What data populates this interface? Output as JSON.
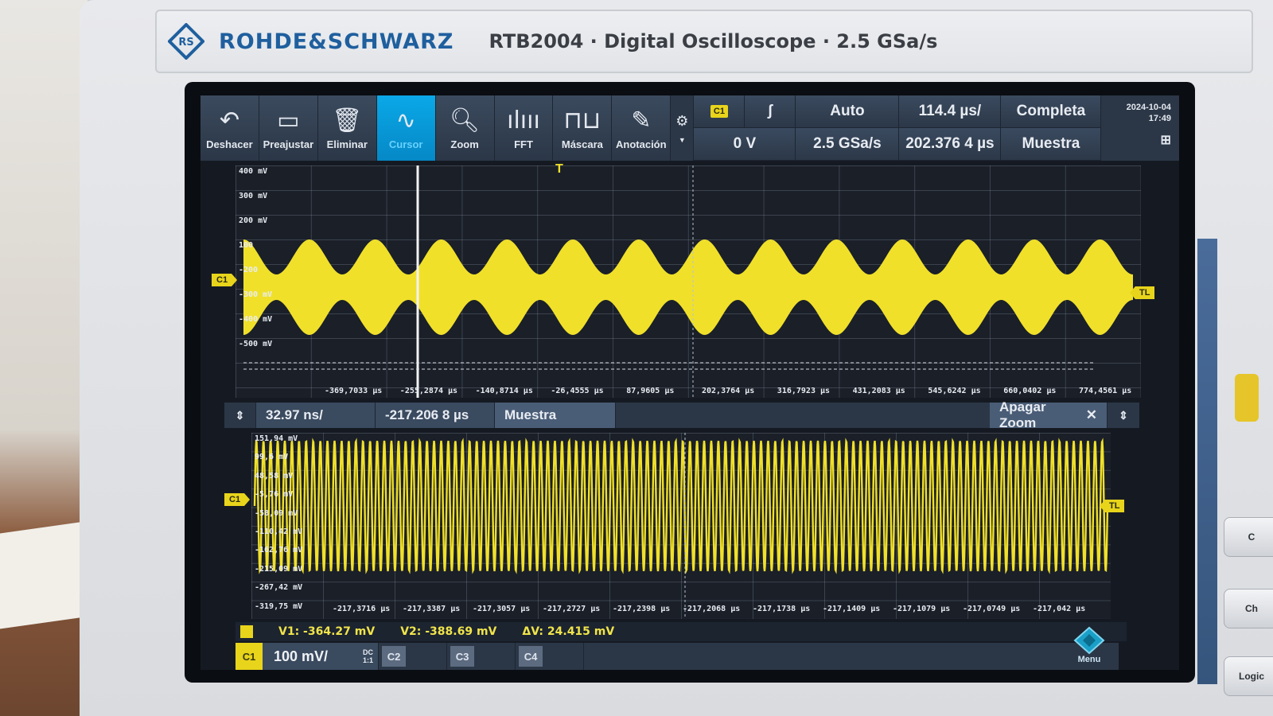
{
  "brand": {
    "name": "ROHDE&SCHWARZ",
    "model_line": "RTB2004 · Digital Oscilloscope · 2.5 GSa/s"
  },
  "toolbar": {
    "tools": [
      {
        "label": "Deshacer",
        "icon": "undo-icon"
      },
      {
        "label": "Preajustar",
        "icon": "preset-icon"
      },
      {
        "label": "Eliminar",
        "icon": "trash-icon"
      },
      {
        "label": "Cursor",
        "icon": "cursor-wave-icon",
        "active": true
      },
      {
        "label": "Zoom",
        "icon": "zoom-icon"
      },
      {
        "label": "FFT",
        "icon": "fft-icon"
      },
      {
        "label": "Máscara",
        "icon": "mask-icon"
      },
      {
        "label": "Anotación",
        "icon": "pencil-icon"
      }
    ],
    "trigger_source": "C1",
    "trigger_slope_icon": "rising-edge-icon",
    "trigger_mode": "Auto",
    "trigger_level": "0 V",
    "sample_rate": "2.5 GSa/s",
    "time_scale": "114.4 µs/",
    "time_position": "202.376 4 µs",
    "acq_mode": "Completa",
    "acq_type": "Muestra",
    "date": "2024-10-04",
    "time": "17:49"
  },
  "main_plot": {
    "y_labels": [
      "400 mV",
      "300 mV",
      "200 mV",
      "100",
      "-200",
      "-300 mV",
      "-400 mV",
      "-500 mV"
    ],
    "x_labels": [
      "-369,7033 µs",
      "-255,2874 µs",
      "-140,8714 µs",
      "-26,4555 µs",
      "87,9605 µs",
      "202,3764 µs",
      "316,7923 µs",
      "431,2083 µs",
      "545,6242 µs",
      "660,0402 µs",
      "774,4561 µs"
    ],
    "channel_marker": "C1",
    "trigger_marker": "TL"
  },
  "zoom_bar": {
    "time_scale": "32.97 ns/",
    "position": "-217.206 8 µs",
    "mode": "Muestra",
    "off_label": "Apagar Zoom"
  },
  "zoom_plot": {
    "y_labels": [
      "151,94 mV",
      "99,6 mV",
      "48,58 mV",
      "-5,76 mV",
      "-58,09 mV",
      "-110,42 mV",
      "-162,76 mV",
      "-215,09 mV",
      "-267,42 mV",
      "-319,75 mV"
    ],
    "x_labels": [
      "-217,3716 µs",
      "-217,3387 µs",
      "-217,3057 µs",
      "-217,2727 µs",
      "-217,2398 µs",
      "-217,2068 µs",
      "-217,1738 µs",
      "-217,1409 µs",
      "-217,1079 µs",
      "-217,0749 µs",
      "-217,042 µs"
    ],
    "channel_marker": "C1",
    "trigger_marker": "TL"
  },
  "cursor_readout": {
    "v1": "V1: -364.27 mV",
    "v2": "V2: -388.69 mV",
    "dv": "ΔV: 24.415 mV"
  },
  "channels": {
    "c1": {
      "label": "C1",
      "scale": "100 mV/",
      "coupling": "DC",
      "probe": "1:1"
    },
    "c2": {
      "label": "C2"
    },
    "c3": {
      "label": "C3"
    },
    "c4": {
      "label": "C4"
    },
    "menu_label": "Menu"
  },
  "side_keys": [
    "C",
    "Ch",
    "Logic"
  ],
  "colors": {
    "trace": "#f0e02a",
    "accent_active": "#0aa8e8",
    "brand_blue": "#1f5f9e"
  }
}
